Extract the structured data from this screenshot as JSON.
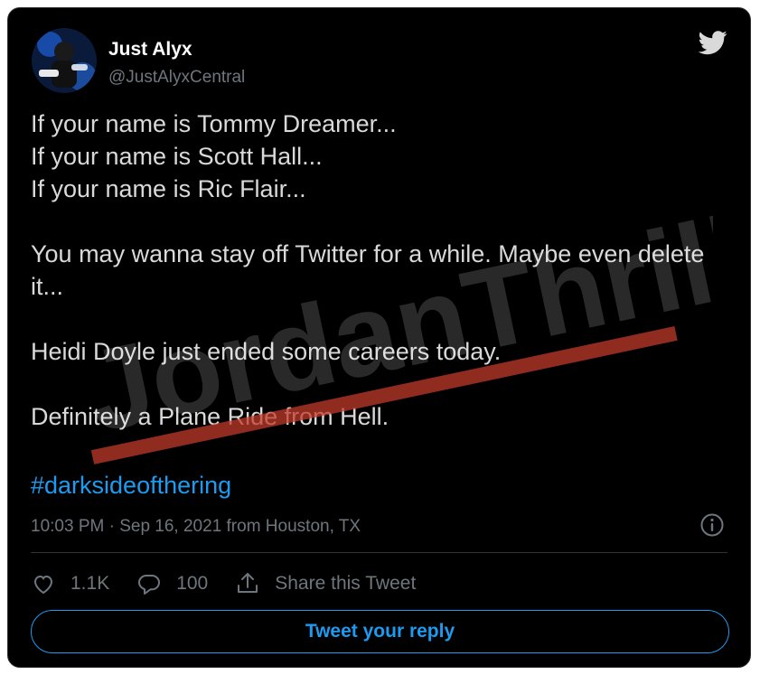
{
  "author": {
    "name": "Just Alyx",
    "handle": "@JustAlyxCentral"
  },
  "tweet": {
    "lines": [
      "If your name is Tommy Dreamer...",
      "If your name is Scott Hall...",
      "If your name is Ric Flair..."
    ],
    "para2": "You may wanna stay off Twitter for a while. Maybe even delete it...",
    "para3": "Heidi Doyle just ended some careers today.",
    "para4": "Definitely a Plane Ride from Hell.",
    "hashtag": "#darksideofthering"
  },
  "meta": {
    "timestamp": "10:03 PM · Sep 16, 2021 from Houston, TX"
  },
  "actions": {
    "likes": "1.1K",
    "replies": "100",
    "share_label": "Share this Tweet"
  },
  "reply_button": "Tweet your reply",
  "watermark": {
    "text": "JordanThrilla."
  },
  "colors": {
    "background": "#000000",
    "text": "#d9d9d9",
    "muted": "#6e767d",
    "accent": "#1d9bf0",
    "watermark_red": "#c0392b"
  },
  "icons": [
    "twitter-bird-icon",
    "info-icon",
    "heart-icon",
    "reply-icon",
    "share-icon"
  ]
}
